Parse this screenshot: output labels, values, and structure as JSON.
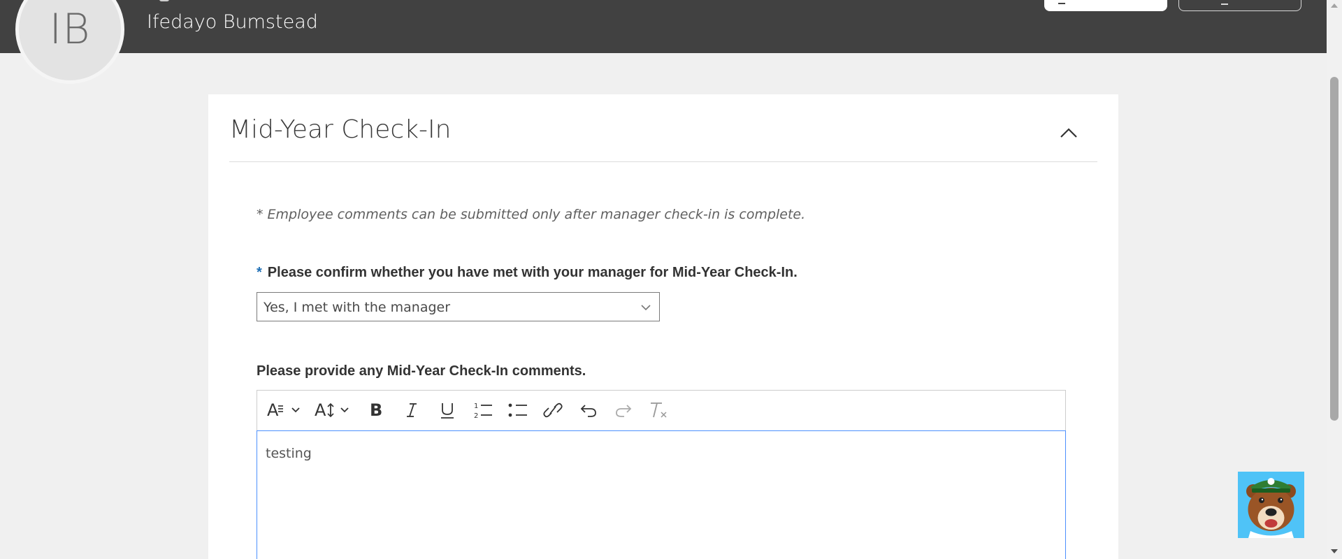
{
  "header": {
    "avatar_initials": "IB",
    "user_name": "Ifedayo Bumstead"
  },
  "section": {
    "title": "Mid-Year Check-In",
    "collapse_icon": "chevron-up-icon"
  },
  "notice": "* Employee comments can be submitted only after manager check-in is complete.",
  "question": {
    "required_marker": "*",
    "label": "Please confirm whether you have met with your manager for Mid-Year Check-In.",
    "selected_value": "Yes, I met with the manager"
  },
  "comments": {
    "label": "Please provide any Mid-Year Check-In comments.",
    "text": "testing",
    "toolbar": [
      "font-style-dropdown",
      "font-size-dropdown",
      "bold-icon",
      "italic-icon",
      "underline-icon",
      "ordered-list-icon",
      "bullet-list-icon",
      "link-icon",
      "undo-icon",
      "redo-icon",
      "clear-formatting-icon"
    ]
  },
  "colors": {
    "header_bg": "#414141",
    "page_bg": "#f0f0f0",
    "required_marker": "#1f6fb5",
    "editor_focus_border": "#4d90fe",
    "mascot_bg": "#4fc3f7"
  },
  "chatbot": {
    "icon": "bear-mascot-icon"
  }
}
